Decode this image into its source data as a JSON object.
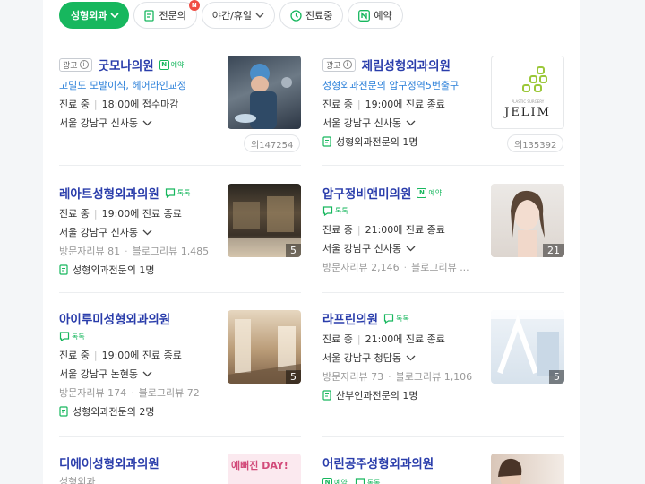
{
  "filters": [
    {
      "label": "성형외과",
      "active": true
    },
    {
      "label": "전문의",
      "badge": "N"
    },
    {
      "label": "야간/휴일"
    },
    {
      "label": "진료중"
    },
    {
      "label": "예약"
    }
  ],
  "colors": {
    "accent": "#17b75e",
    "name": "#2a3dab",
    "slogan": "#2a7fd9",
    "badge": "#f04d44"
  },
  "ad_label": "광고",
  "tag_reservation": "예약",
  "tag_talk": "톡톡",
  "cards": [
    {
      "name": "굿모나의원",
      "slogan": "고밀도 모발이식, 헤어라인교정",
      "status": "진료 중",
      "hours": "18:00에 접수마감",
      "location": "서울 강남구 신사동",
      "reg": "의147254"
    },
    {
      "name": "제림성형외과의원",
      "slogan": "성형외과전문의 압구정역5번출구",
      "status": "진료 중",
      "hours": "19:00에 진료 종료",
      "location": "서울 강남구 신사동",
      "specialist": "성형외과전문의 1명",
      "reg": "의135392",
      "logo_text": "JELIM",
      "logo_sub": "PLASTIC SURGERY"
    },
    {
      "name": "레아트성형외과의원",
      "status": "진료 중",
      "hours": "19:00에 진료 종료",
      "location": "서울 강남구 신사동",
      "reviews_visitor": "방문자리뷰 81",
      "reviews_blog": "블로그리뷰 1,485",
      "specialist": "성형외과전문의 1명",
      "photo_count": "5"
    },
    {
      "name": "압구정비앤미의원",
      "status": "진료 중",
      "hours": "21:00에 진료 종료",
      "location": "서울 강남구 신사동",
      "reviews_visitor": "방문자리뷰 2,146",
      "reviews_blog": "블로그리뷰 ...",
      "photo_count": "21"
    },
    {
      "name": "아이루미성형외과의원",
      "status": "진료 중",
      "hours": "19:00에 진료 종료",
      "location": "서울 강남구 논현동",
      "reviews_visitor": "방문자리뷰 174",
      "reviews_blog": "블로그리뷰 72",
      "specialist": "성형외과전문의 2명",
      "photo_count": "5"
    },
    {
      "name": "라프린의원",
      "status": "진료 중",
      "hours": "21:00에 진료 종료",
      "location": "서울 강남구 청담동",
      "reviews_visitor": "방문자리뷰 73",
      "reviews_blog": "블로그리뷰 1,106",
      "specialist": "산부인과전문의 1명",
      "photo_count": "5"
    },
    {
      "name": "디에이성형외과의원",
      "category": "성형외과",
      "thumb_text": "예뻐진 DAY!"
    },
    {
      "name": "어린공주성형외과의원"
    }
  ]
}
